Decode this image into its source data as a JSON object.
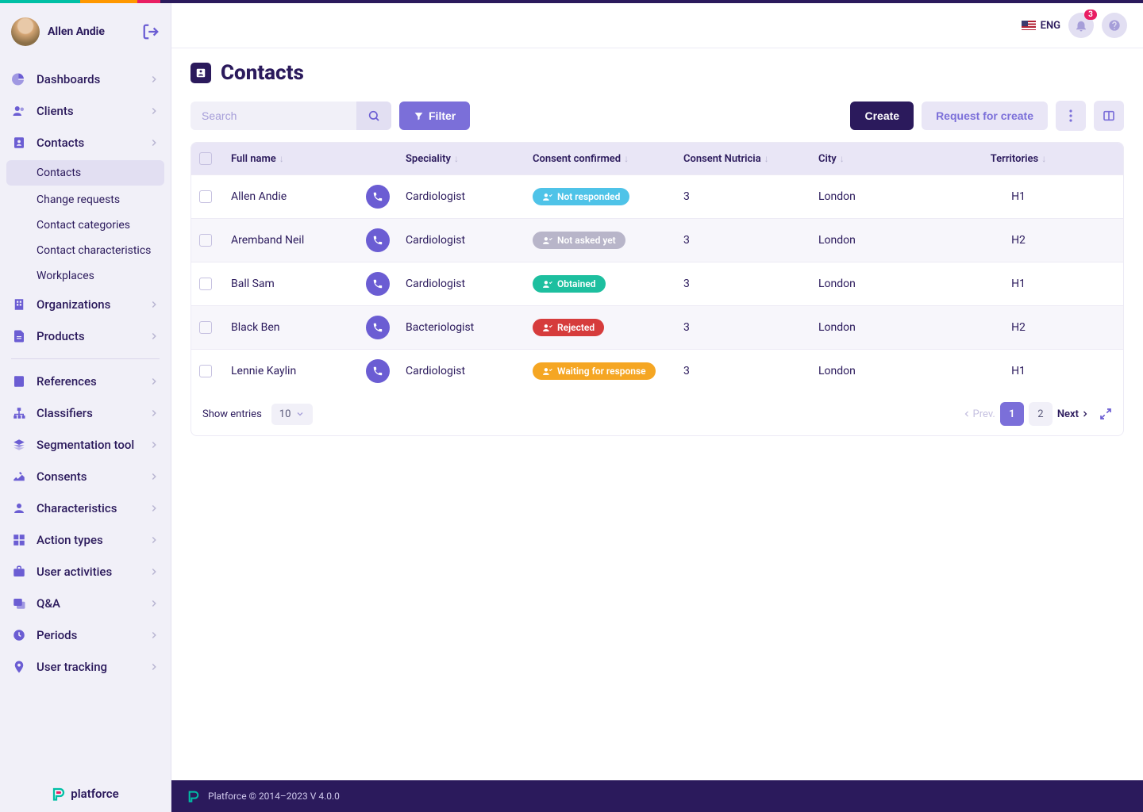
{
  "accent": {
    "stripe": [
      "#00BFA5",
      "#FF9800",
      "#E91E63",
      "#2B1A5C"
    ]
  },
  "user": {
    "name": "Allen Andie"
  },
  "nav": [
    {
      "icon": "pie",
      "label": "Dashboards",
      "chev": "right"
    },
    {
      "icon": "users",
      "label": "Clients",
      "chev": "right"
    },
    {
      "icon": "contact",
      "label": "Contacts",
      "chev": "down",
      "sub": [
        {
          "label": "Contacts",
          "active": true
        },
        {
          "label": "Change requests"
        },
        {
          "label": "Contact categories"
        },
        {
          "label": "Contact characteristics"
        },
        {
          "label": "Workplaces"
        }
      ]
    },
    {
      "icon": "building",
      "label": "Organizations",
      "chev": "right"
    },
    {
      "icon": "file",
      "label": "Products",
      "chev": "right"
    },
    {
      "divider": true
    },
    {
      "icon": "book",
      "label": "References",
      "chev": "right"
    },
    {
      "icon": "sitemap",
      "label": "Classifiers",
      "chev": "right"
    },
    {
      "icon": "layers",
      "label": "Segmentation tool",
      "chev": "right"
    },
    {
      "icon": "signature",
      "label": "Consents",
      "chev": "right"
    },
    {
      "icon": "person",
      "label": "Characteristics",
      "chev": "right"
    },
    {
      "icon": "grid",
      "label": "Action types",
      "chev": "right"
    },
    {
      "icon": "briefcase",
      "label": "User activities",
      "chev": "right"
    },
    {
      "icon": "qa",
      "label": "Q&A",
      "chev": "right"
    },
    {
      "icon": "clock",
      "label": "Periods",
      "chev": "right"
    },
    {
      "icon": "pin",
      "label": "User tracking",
      "chev": "right"
    }
  ],
  "brand": "platforce",
  "header": {
    "lang": "ENG",
    "notif_count": "3"
  },
  "page": {
    "title": "Contacts"
  },
  "toolbar": {
    "search_placeholder": "Search",
    "filter": "Filter",
    "create": "Create",
    "request": "Request for create"
  },
  "table": {
    "columns": [
      "Full name",
      "Speciality",
      "Consent confirmed",
      "Consent Nutricia",
      "City",
      "Territories"
    ],
    "rows": [
      {
        "name": "Allen Andie",
        "spec": "Cardiologist",
        "consent": {
          "label": "Not responded",
          "color": "#4FC3E8"
        },
        "nutricia": "3",
        "city": "London",
        "terr": "H1"
      },
      {
        "name": "Aremband Neil",
        "spec": "Cardiologist",
        "consent": {
          "label": "Not asked yet",
          "color": "#B8B5C9"
        },
        "nutricia": "3",
        "city": "London",
        "terr": "H2"
      },
      {
        "name": "Ball Sam",
        "spec": "Cardiologist",
        "consent": {
          "label": "Obtained",
          "color": "#1DBF9F"
        },
        "nutricia": "3",
        "city": "London",
        "terr": "H1"
      },
      {
        "name": "Black Ben",
        "spec": "Bacteriologist",
        "consent": {
          "label": "Rejected",
          "color": "#D63C3C"
        },
        "nutricia": "3",
        "city": "London",
        "terr": "H2"
      },
      {
        "name": "Lennie Kaylin",
        "spec": "Cardiologist",
        "consent": {
          "label": "Waiting for response",
          "color": "#F5A623"
        },
        "nutricia": "3",
        "city": "London",
        "terr": "H1"
      }
    ]
  },
  "footer_controls": {
    "entries_label": "Show entries",
    "entries_value": "10",
    "prev": "Prev.",
    "next": "Next",
    "pages": [
      "1",
      "2"
    ],
    "current_page": "1"
  },
  "footer": "Platforce © 2014–2023 V 4.0.0"
}
